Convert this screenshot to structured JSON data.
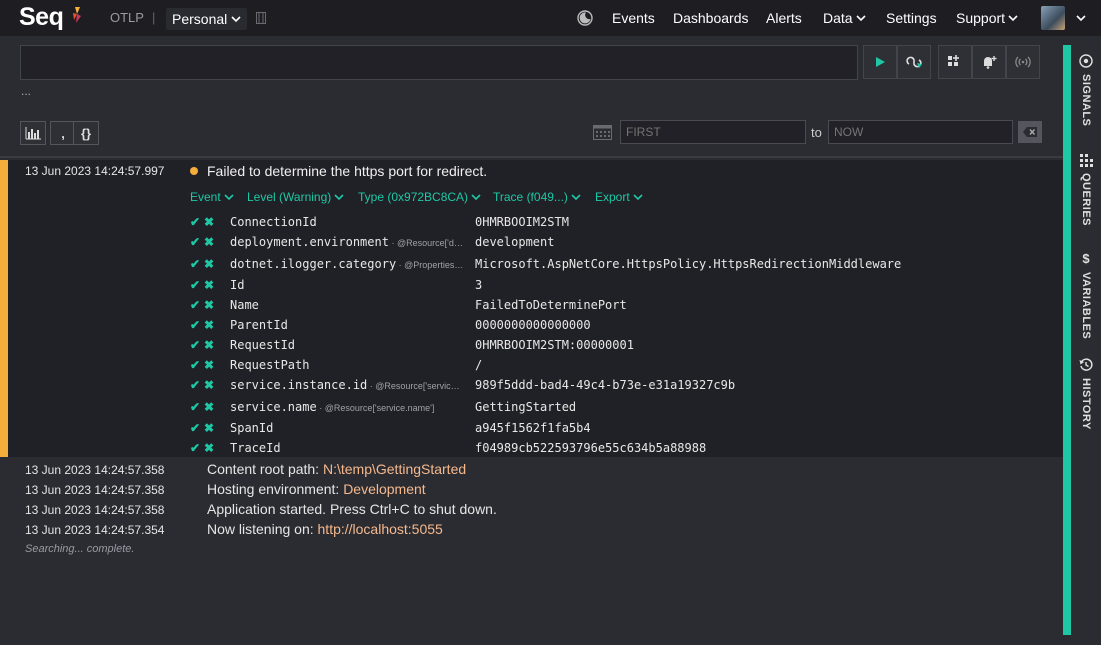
{
  "topbar": {
    "logo": "Seq",
    "otlp": "OTLP",
    "separator": "|",
    "workspace": "Personal",
    "nav": {
      "events": "Events",
      "dashboards": "Dashboards",
      "alerts": "Alerts",
      "data": "Data",
      "settings": "Settings",
      "support": "Support"
    }
  },
  "query": {
    "value": "",
    "placeholder": "",
    "ellipsis": "..."
  },
  "range": {
    "from_placeholder": "FIRST",
    "to_label": "to",
    "to_placeholder": "NOW"
  },
  "toolbar": {
    "comma_label": ",",
    "braces_label": "{}"
  },
  "sidebar": {
    "signals": "SIGNALS",
    "queries": "QUERIES",
    "variables": "VARIABLES",
    "history": "HISTORY"
  },
  "expanded_event": {
    "timestamp": "13 Jun 2023  14:24:57.997",
    "message": "Failed to determine the https port for redirect.",
    "menus": {
      "event": "Event",
      "level": "Level (Warning)",
      "type": "Type (0x972BC8CA)",
      "trace": "Trace (f049...)",
      "export": "Export"
    },
    "properties": [
      {
        "name": "ConnectionId",
        "path": "",
        "value": "0HMRBOOIM2STM"
      },
      {
        "name": "deployment.environment",
        "path": " · @Resource['d…",
        "value": "development"
      },
      {
        "name": "dotnet.ilogger.category",
        "path": " · @Properties…",
        "value": "Microsoft.AspNetCore.HttpsPolicy.HttpsRedirectionMiddleware"
      },
      {
        "name": "Id",
        "path": "",
        "value": "3"
      },
      {
        "name": "Name",
        "path": "",
        "value": "FailedToDeterminePort"
      },
      {
        "name": "ParentId",
        "path": "",
        "value": "0000000000000000"
      },
      {
        "name": "RequestId",
        "path": "",
        "value": "0HMRBOOIM2STM:00000001"
      },
      {
        "name": "RequestPath",
        "path": "",
        "value": "/"
      },
      {
        "name": "service.instance.id",
        "path": " · @Resource['servic…",
        "value": "989f5ddd-bad4-49c4-b73e-e31a19327c9b"
      },
      {
        "name": "service.name",
        "path": " · @Resource['service.name']",
        "value": "GettingStarted"
      },
      {
        "name": "SpanId",
        "path": "",
        "value": "a945f1562f1fa5b4"
      },
      {
        "name": "TraceId",
        "path": "",
        "value": "f04989cb522593796e55c634b5a88988"
      }
    ]
  },
  "events": [
    {
      "timestamp": "13 Jun 2023  14:24:57.358",
      "prefix": "Content root path: ",
      "highlight": "N:\\temp\\GettingStarted",
      "suffix": ""
    },
    {
      "timestamp": "13 Jun 2023  14:24:57.358",
      "prefix": "Hosting environment: ",
      "highlight": "Development",
      "suffix": ""
    },
    {
      "timestamp": "13 Jun 2023  14:24:57.358",
      "prefix": "Application started. Press Ctrl+C to shut down.",
      "highlight": "",
      "suffix": ""
    },
    {
      "timestamp": "13 Jun 2023  14:24:57.354",
      "prefix": "Now listening on: ",
      "highlight": "http://localhost:5055",
      "suffix": ""
    }
  ],
  "status": "Searching... complete.",
  "colors": {
    "accent": "#1fc8a4",
    "warning": "#f5ad3b",
    "highlight": "#f5b98c"
  }
}
